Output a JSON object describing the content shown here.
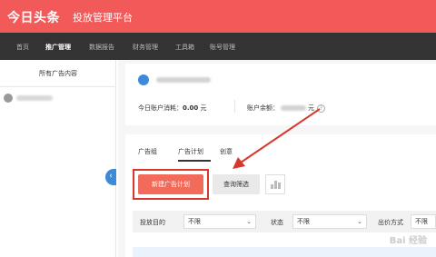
{
  "header": {
    "logo": "今日头条",
    "platform": "投放管理平台"
  },
  "nav": [
    "首页",
    "推广管理",
    "数据报告",
    "财务管理",
    "工具箱",
    "账号管理"
  ],
  "nav_active": 1,
  "sidebar": {
    "title": "所有广告内容",
    "collapse_glyph": "‹"
  },
  "account": {
    "spend_label": "今日账户消耗：",
    "spend_value": "0.00",
    "spend_unit": "元",
    "balance_label": "账户余额：",
    "balance_unit": "元",
    "help_glyph": "?"
  },
  "tabs": [
    "广告组",
    "广告计划",
    "创意"
  ],
  "toolbar": {
    "new_plan": "新建广告计划",
    "query": "查询筛选"
  },
  "filters": {
    "goal_label": "投放目的",
    "goal_value": "不限",
    "status_label": "状态",
    "status_value": "不限",
    "bid_label": "出价方式",
    "bid_value": "不限"
  },
  "caret": "⌄",
  "watermark": "Bai 经验",
  "colors": {
    "header": "#f25a5a",
    "nav": "#333333",
    "primary_button": "#f26a5a",
    "highlight": "#d9362e",
    "accent": "#3d8ad8"
  }
}
